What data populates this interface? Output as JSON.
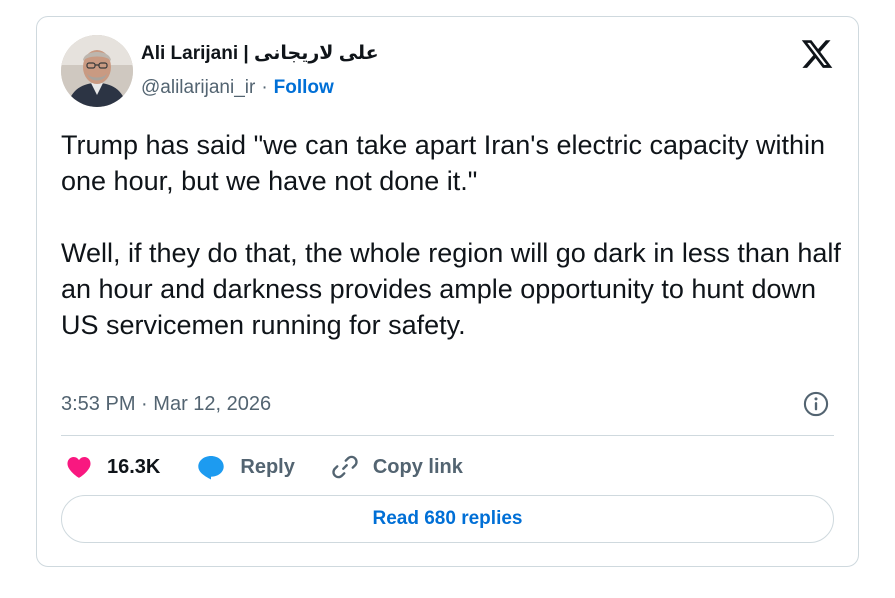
{
  "author": {
    "name": "Ali Larijani | علی لاریجانی",
    "handle": "@alilarijani_ir",
    "separator": "·",
    "follow_label": "Follow"
  },
  "tweet": {
    "paragraphs": [
      "Trump has said \"we can take apart Iran's electric capacity within one hour, but we have not done it.\"",
      "Well, if they do that, the whole region will go dark in less than half an hour and darkness provides ample opportunity to hunt down US servicemen running for safety."
    ],
    "time": "3:53 PM",
    "meta_separator": "·",
    "date": "Mar 12, 2026"
  },
  "actions": {
    "likes": "16.3K",
    "reply_label": "Reply",
    "copy_link_label": "Copy link"
  },
  "read_replies_label": "Read 680 replies",
  "colors": {
    "like": "#f91880",
    "reply_bubble": "#1d9bf0",
    "link": "#006fd6",
    "secondary_text": "#536471",
    "border": "#cfd9de"
  },
  "icons": [
    "x-logo-icon",
    "info-icon",
    "heart-icon",
    "reply-bubble-icon",
    "link-icon"
  ]
}
